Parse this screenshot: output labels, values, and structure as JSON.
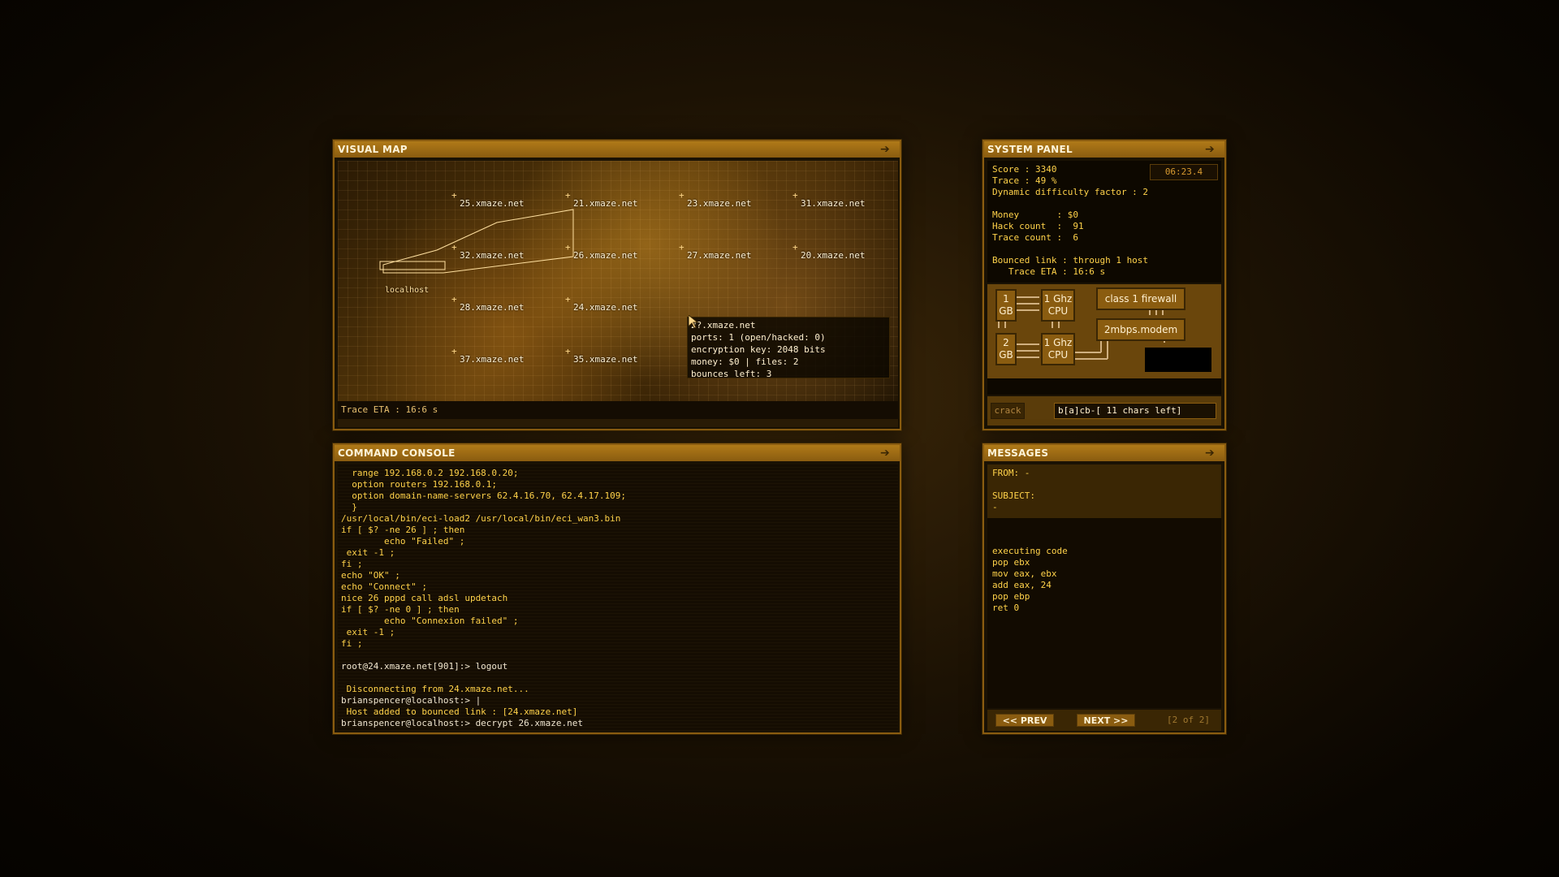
{
  "visual_map": {
    "title": "VISUAL MAP",
    "hosts": [
      {
        "id": "h25",
        "label": "25.xmaze.net"
      },
      {
        "id": "h21",
        "label": "21.xmaze.net"
      },
      {
        "id": "h23",
        "label": "23.xmaze.net"
      },
      {
        "id": "h31",
        "label": "31.xmaze.net"
      },
      {
        "id": "h32",
        "label": "32.xmaze.net"
      },
      {
        "id": "h26",
        "label": "26.xmaze.net"
      },
      {
        "id": "h27",
        "label": "27.xmaze.net"
      },
      {
        "id": "h20",
        "label": "20.xmaze.net"
      },
      {
        "id": "h28",
        "label": "28.xmaze.net"
      },
      {
        "id": "h24",
        "label": "24.xmaze.net"
      },
      {
        "id": "h37",
        "label": "37.xmaze.net"
      },
      {
        "id": "h35",
        "label": "35.xmaze.net"
      }
    ],
    "localhost_label": "localhost",
    "tooltip": {
      "host": "2?.xmaze.net",
      "ports": "ports:  1 (open/hacked:  0)",
      "encryption": "encryption key:  2048 bits",
      "money": "money:  $0 | files: 2",
      "bounces": "bounces left: 3"
    },
    "trace_eta": "Trace ETA : 16:6 s"
  },
  "system_panel": {
    "title": "SYSTEM PANEL",
    "timer": "06:23.4",
    "score": "Score : 3340",
    "trace": "Trace : 49 %",
    "difficulty": "Dynamic difficulty factor : 2",
    "money": "Money       : $0",
    "hack_count": "Hack count  :  91",
    "trace_count": "Trace count :  6",
    "bounced_link": "Bounced link : through 1 host",
    "trace_eta": "   Trace ETA : 16:6 s",
    "hardware": {
      "ram1": "1\nGB",
      "ram2": "2\nGB",
      "cpu1": "1 Ghz\nCPU",
      "cpu2": "1 Ghz\nCPU",
      "firewall": "class 1 firewall",
      "modem": "2mbps.modem"
    },
    "crack_button": "crack",
    "crack_input": "b[a]cb-[ 11 chars left]"
  },
  "command_console": {
    "title": "COMMAND CONSOLE",
    "lines": [
      {
        "text": "  range 192.168.0.2 192.168.0.20;",
        "color": "yellow"
      },
      {
        "text": "  option routers 192.168.0.1;",
        "color": "yellow"
      },
      {
        "text": "  option domain-name-servers 62.4.16.70, 62.4.17.109;",
        "color": "yellow"
      },
      {
        "text": "  }",
        "color": "yellow"
      },
      {
        "text": "/usr/local/bin/eci-load2 /usr/local/bin/eci_wan3.bin",
        "color": "yellow"
      },
      {
        "text": "if [ $? -ne 26 ] ; then",
        "color": "yellow"
      },
      {
        "text": "        echo \"Failed\" ;",
        "color": "yellow"
      },
      {
        "text": " exit -1 ;",
        "color": "yellow"
      },
      {
        "text": "fi ;",
        "color": "yellow"
      },
      {
        "text": "echo \"OK\" ;",
        "color": "yellow"
      },
      {
        "text": "echo \"Connect\" ;",
        "color": "yellow"
      },
      {
        "text": "nice 26 pppd call adsl updetach",
        "color": "yellow"
      },
      {
        "text": "if [ $? -ne 0 ] ; then",
        "color": "yellow"
      },
      {
        "text": "        echo \"Connexion failed\" ;",
        "color": "yellow"
      },
      {
        "text": " exit -1 ;",
        "color": "yellow"
      },
      {
        "text": "fi ;",
        "color": "yellow"
      },
      {
        "text": "",
        "color": "yellow"
      },
      {
        "text": "root@24.xmaze.net[901]:> logout",
        "color": "white"
      },
      {
        "text": "",
        "color": "yellow"
      },
      {
        "text": " Disconnecting from 24.xmaze.net...",
        "color": "yellow"
      },
      {
        "text": "brianspencer@localhost:> |",
        "color": "white"
      },
      {
        "text": " Host added to bounced link : [24.xmaze.net]",
        "color": "yellow"
      },
      {
        "text": "brianspencer@localhost:> decrypt 26.xmaze.net",
        "color": "white"
      }
    ]
  },
  "messages": {
    "title": "MESSAGES",
    "from": "FROM: -",
    "subject_label": "SUBJECT:",
    "subject": "-",
    "body": [
      "executing code",
      "pop ebx",
      "mov eax, ebx",
      "add eax, 24",
      "pop ebp",
      "ret 0"
    ],
    "prev": "<< PREV",
    "next": "NEXT >>",
    "page": "[2 of 2]"
  },
  "colors": {
    "accent": "#8a5c10",
    "text_yellow": "#ffd24a",
    "text_white": "#f0e6d0"
  },
  "icons": {
    "panel_arrow": "arrow-icon",
    "cursor": "mouse-cursor-icon"
  }
}
